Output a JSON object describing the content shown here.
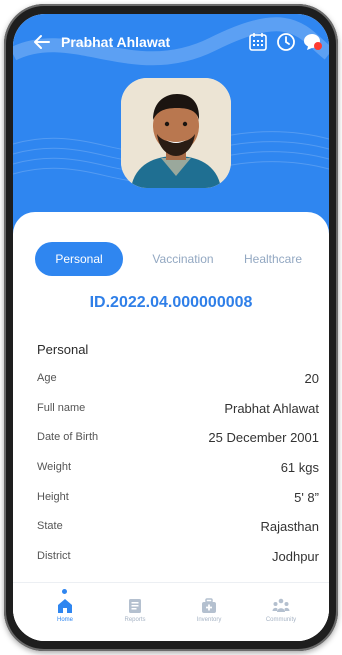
{
  "header": {
    "user_name": "Prabhat Ahlawat",
    "icons": [
      "back-arrow-icon",
      "calendar-icon",
      "clock-icon",
      "chat-icon"
    ],
    "accent": "#2f86f0",
    "notification_dot": "#ff3b30"
  },
  "tabs": [
    {
      "label": "Personal",
      "active": true
    },
    {
      "label": "Vaccination",
      "active": false
    },
    {
      "label": "Healthcare",
      "active": false
    }
  ],
  "record_id": "ID.2022.04.000000008",
  "section": {
    "title": "Personal",
    "rows": [
      {
        "label": "Age",
        "value": "20"
      },
      {
        "label": "Full name",
        "value": "Prabhat Ahlawat"
      },
      {
        "label": "Date of Birth",
        "value": "25 December 2001"
      },
      {
        "label": "Weight",
        "value": "61 kgs"
      },
      {
        "label": "Height",
        "value": "5' 8”"
      },
      {
        "label": "State",
        "value": "Rajasthan"
      },
      {
        "label": "District",
        "value": "Jodhpur"
      }
    ]
  },
  "bottom_nav": [
    {
      "label": "Home",
      "icon": "home-icon",
      "active": true
    },
    {
      "label": "Reports",
      "icon": "reports-icon",
      "active": false
    },
    {
      "label": "Inventory",
      "icon": "inventory-icon",
      "active": false
    },
    {
      "label": "Community",
      "icon": "community-icon",
      "active": false
    }
  ]
}
